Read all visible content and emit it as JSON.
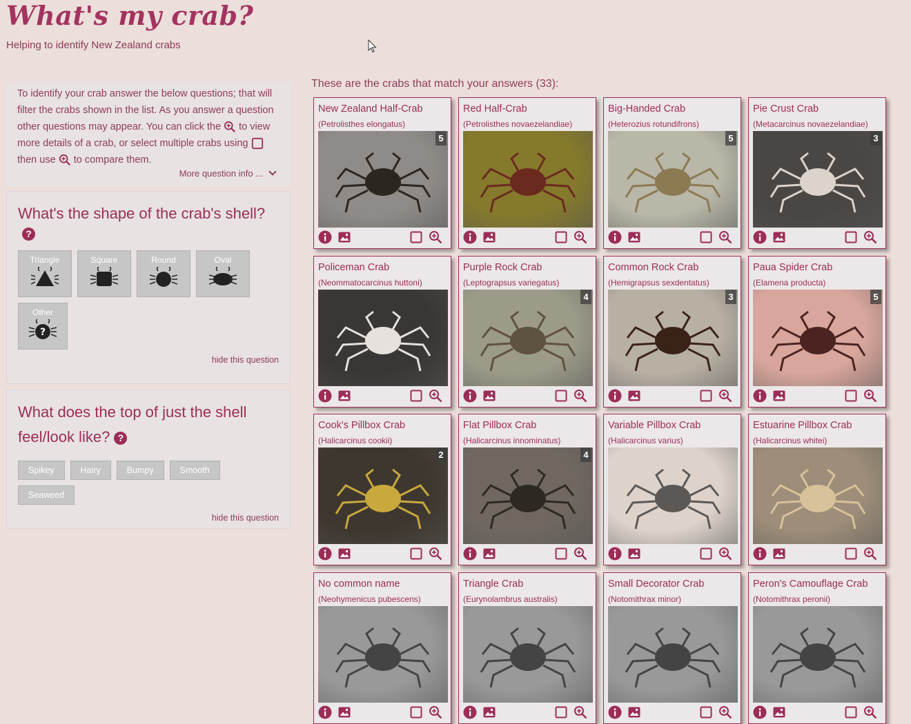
{
  "header": {
    "title": "What's my crab?",
    "subtitle": "Helping to identify New Zealand crabs"
  },
  "intro": {
    "part1": "To identify your crab answer the below questions; that will filter the crabs shown in the list. As you answer a question other questions may appear. You can click the",
    "part2": "to view more details of a crab, or select multiple crabs using",
    "part3": "then use",
    "part4": "to compare them.",
    "more_info": "More question info ..."
  },
  "questions": [
    {
      "title": "What's the shape of the crab's shell?",
      "options": [
        "Triangle",
        "Square",
        "Round",
        "Oval",
        "Other"
      ],
      "hide": "hide this question"
    },
    {
      "title": "What does the top of just the shell feel/look like?",
      "options": [
        "Spikey",
        "Hairy",
        "Bumpy",
        "Smooth",
        "Seaweed"
      ],
      "hide": "hide this question"
    }
  ],
  "results": {
    "heading": "These are the crabs that match your answers (33):",
    "crabs": [
      {
        "name": "New Zealand Half-Crab",
        "sci": "(Petrolisthes elongatus)",
        "count": "5",
        "bg": "#8f8b88",
        "fg": "#2c2620"
      },
      {
        "name": "Red Half-Crab",
        "sci": "(Petrolisthes novaezelandiae)",
        "count": "",
        "bg": "#857a2c",
        "fg": "#6b2a1e"
      },
      {
        "name": "Big-Handed Crab",
        "sci": "(Heterozius rotundifrons)",
        "count": "5",
        "bg": "#b9b7a8",
        "fg": "#8c7a52"
      },
      {
        "name": "Pie Crust Crab",
        "sci": "(Metacarcinus novaezelandiae)",
        "count": "3",
        "bg": "#4a4644",
        "fg": "#dcd4cc"
      },
      {
        "name": "Policeman Crab",
        "sci": "(Neommatocarcinus huttoni)",
        "count": "",
        "bg": "#393735",
        "fg": "#e6e1dc"
      },
      {
        "name": "Purple Rock Crab",
        "sci": "(Leptograpsus variegatus)",
        "count": "4",
        "bg": "#9c9a88",
        "fg": "#5e5240"
      },
      {
        "name": "Common Rock Crab",
        "sci": "(Hemigrapsus sexdentatus)",
        "count": "3",
        "bg": "#b9b0a4",
        "fg": "#3a2218"
      },
      {
        "name": "Paua Spider Crab",
        "sci": "(Elamena producta)",
        "count": "5",
        "bg": "#d8a69c",
        "fg": "#4b2320"
      },
      {
        "name": "Cook's Pillbox Crab",
        "sci": "(Halicarcinus cookii)",
        "count": "2",
        "bg": "#3e372f",
        "fg": "#c9a93e"
      },
      {
        "name": "Flat Pillbox Crab",
        "sci": "(Halicarcinus innominatus)",
        "count": "4",
        "bg": "#6f6760",
        "fg": "#2e2823"
      },
      {
        "name": "Variable Pillbox Crab",
        "sci": "(Halicarcinus varius)",
        "count": "",
        "bg": "#ddd3cb",
        "fg": "#5c5856"
      },
      {
        "name": "Estuarine Pillbox Crab",
        "sci": "(Halicarcinus whitei)",
        "count": "",
        "bg": "#9d8d79",
        "fg": "#d8c29a"
      },
      {
        "name": "No common name",
        "sci": "(Neohymenicus pubescens)",
        "count": "",
        "bg": "#999",
        "fg": "#444"
      },
      {
        "name": "Triangle Crab",
        "sci": "(Eurynolambrus australis)",
        "count": "",
        "bg": "#999",
        "fg": "#444"
      },
      {
        "name": "Small Decorator Crab",
        "sci": "(Notomithrax minor)",
        "count": "",
        "bg": "#999",
        "fg": "#444"
      },
      {
        "name": "Peron's Camouflage Crab",
        "sci": "(Notomithrax peronii)",
        "count": "",
        "bg": "#999",
        "fg": "#444"
      }
    ]
  }
}
